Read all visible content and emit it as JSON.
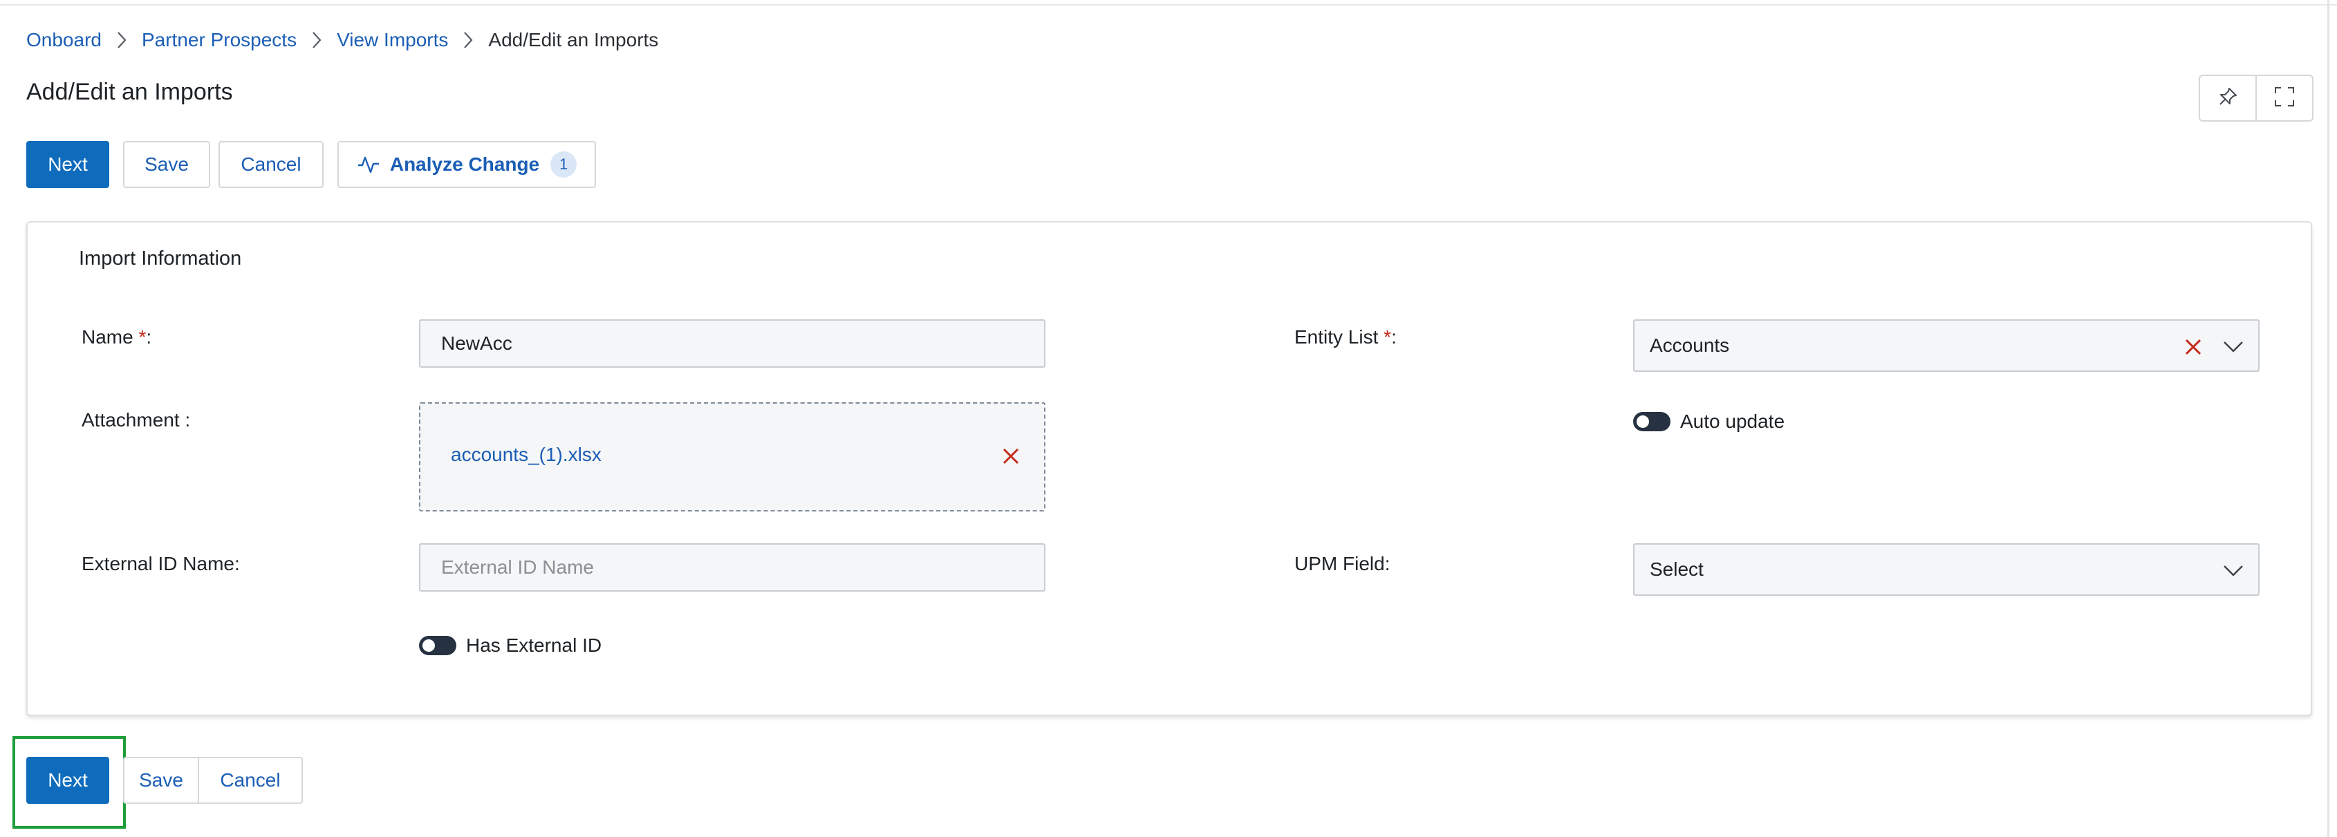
{
  "breadcrumb": {
    "items": [
      "Onboard",
      "Partner Prospects",
      "View Imports"
    ],
    "current": "Add/Edit an Imports"
  },
  "page": {
    "title": "Add/Edit an Imports"
  },
  "toolbar": {
    "next_label": "Next",
    "save_label": "Save",
    "cancel_label": "Cancel",
    "analyze_label": "Analyze Change",
    "analyze_count": "1"
  },
  "top_icons": [
    "pin-icon",
    "fullscreen-icon"
  ],
  "form": {
    "section_title": "Import Information",
    "name_label": "Name",
    "name_value": "NewAcc",
    "entity_label": "Entity List",
    "entity_value": "Accounts",
    "attachment_label": "Attachment :",
    "attachment_file": "accounts_(1).xlsx",
    "auto_update_label": "Auto update",
    "external_id_label": "External ID Name:",
    "external_id_placeholder": "External ID Name",
    "upm_label": "UPM Field:",
    "upm_value": "Select",
    "has_external_label": "Has External ID",
    "required_mark": "*",
    "colon": ":"
  },
  "footer": {
    "next_label": "Next",
    "save_label": "Save",
    "cancel_label": "Cancel"
  },
  "colors": {
    "primary": "#0f6cbd",
    "link": "#1b5eb5",
    "danger": "#c42b1c",
    "highlight": "#1e9e3a"
  }
}
